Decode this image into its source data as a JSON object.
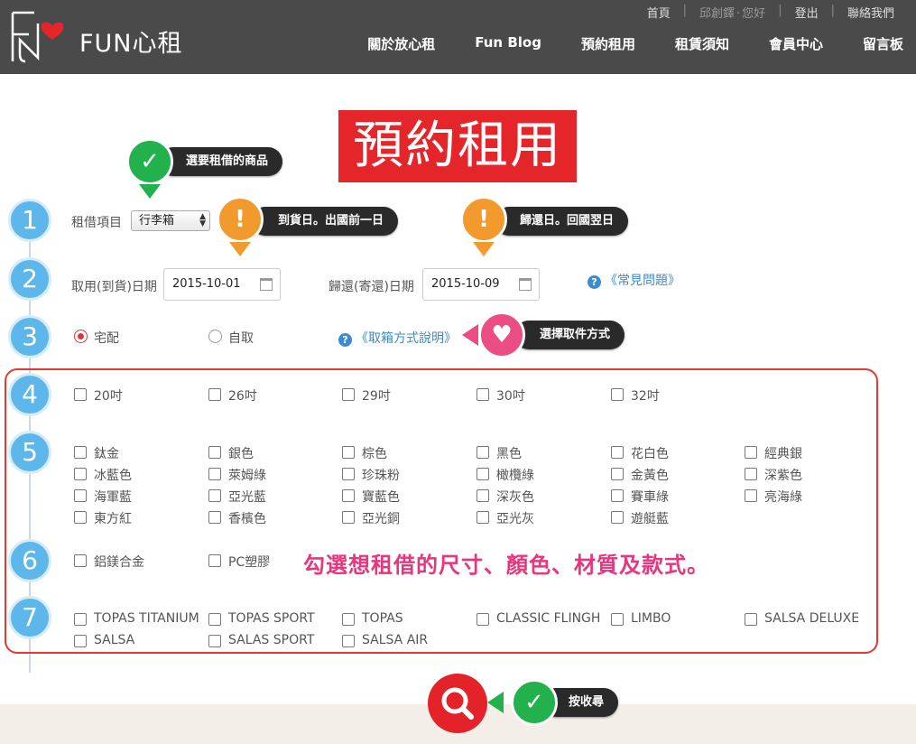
{
  "header": {
    "logo_text": "FUN心租",
    "top_links": [
      "首頁",
      "邱創鐸",
      "您好",
      "登出",
      "聯絡我們"
    ],
    "nav": [
      "關於放心租",
      "Fun Blog",
      "預約租用",
      "租賃須知",
      "會員中心",
      "留言板"
    ]
  },
  "page_title": "預約租用",
  "steps": [
    "1",
    "2",
    "3",
    "4",
    "5",
    "6",
    "7"
  ],
  "callouts": {
    "select_item": "選要租借的商品",
    "delivery_date": "到貨日。出國前一日",
    "return_date": "歸還日。回國翌日",
    "pickup_method": "選擇取件方式",
    "search": "按收尋"
  },
  "form": {
    "item_label": "租借項目",
    "item_value": "行李箱",
    "pickup_date_label": "取用(到貨)日期",
    "pickup_date_value": "2015-10-01",
    "return_date_label": "歸還(寄還)日期",
    "return_date_value": "2015-10-09",
    "faq_link": "《常見問題》",
    "delivery_label": "宅配",
    "self_pickup_label": "自取",
    "pickup_help_link": "《取箱方式說明》"
  },
  "sizes": [
    "20吋",
    "26吋",
    "29吋",
    "30吋",
    "32吋"
  ],
  "colors": [
    "鈦金",
    "銀色",
    "棕色",
    "黑色",
    "花白色",
    "經典銀",
    "冰藍色",
    "萊姆綠",
    "珍珠粉",
    "橄欖綠",
    "金黃色",
    "深紫色",
    "海軍藍",
    "亞光藍",
    "寶藍色",
    "深灰色",
    "賽車綠",
    "亮海綠",
    "東方紅",
    "香檳色",
    "亞光銅",
    "亞光灰",
    "遊艇藍"
  ],
  "materials": [
    "鋁鎂合金",
    "PC塑膠"
  ],
  "models": [
    "TOPAS TITANIUM",
    "TOPAS SPORT",
    "TOPAS",
    "CLASSIC FLINGH",
    "LIMBO",
    "SALSA DELUXE",
    "SALSA",
    "SALAS SPORT",
    "SALSA AIR"
  ],
  "hint": "勾選想租借的尺寸、顏色、材質及款式。",
  "accent_colors": {
    "header": "#4a4a4a",
    "brand_red": "#e4252a",
    "step_blue": "#5db7eb",
    "hint_pink": "#e8357d"
  }
}
